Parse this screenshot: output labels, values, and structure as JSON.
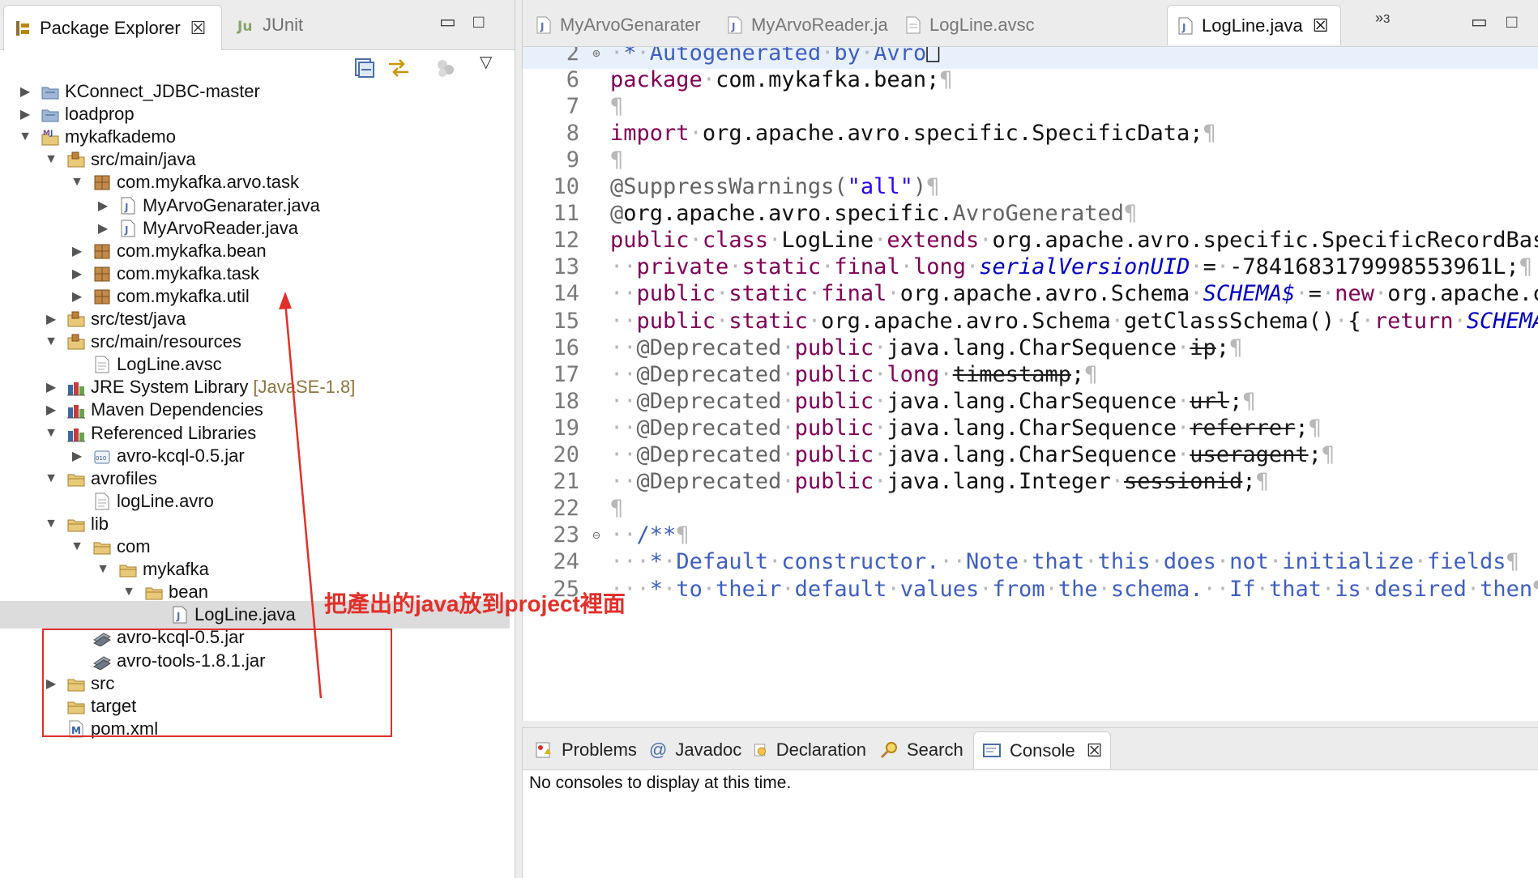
{
  "left_panel": {
    "tabs": [
      {
        "label": "Package Explorer",
        "icon": "package-explorer-icon",
        "active": true
      },
      {
        "label": "JUnit",
        "icon": "junit-icon",
        "active": false
      }
    ],
    "tree": [
      {
        "label": "KConnect_JDBC-master",
        "icon": "project-icon",
        "indent": 0,
        "expand": "collapsed"
      },
      {
        "label": "loadprop",
        "icon": "project-icon",
        "indent": 0,
        "expand": "collapsed"
      },
      {
        "label": "mykafkademo",
        "icon": "maven-project-icon",
        "indent": 0,
        "expand": "expanded"
      },
      {
        "label": "src/main/java",
        "icon": "source-folder-icon",
        "indent": 1,
        "expand": "expanded"
      },
      {
        "label": "com.mykafka.arvo.task",
        "icon": "package-icon",
        "indent": 2,
        "expand": "expanded"
      },
      {
        "label": "MyArvoGenarater.java",
        "icon": "java-file-icon",
        "indent": 3,
        "expand": "collapsed"
      },
      {
        "label": "MyArvoReader.java",
        "icon": "java-file-icon",
        "indent": 3,
        "expand": "collapsed"
      },
      {
        "label": "com.mykafka.bean",
        "icon": "package-icon",
        "indent": 2,
        "expand": "collapsed"
      },
      {
        "label": "com.mykafka.task",
        "icon": "package-icon",
        "indent": 2,
        "expand": "collapsed"
      },
      {
        "label": "com.mykafka.util",
        "icon": "package-icon",
        "indent": 2,
        "expand": "collapsed"
      },
      {
        "label": "src/test/java",
        "icon": "source-folder-icon",
        "indent": 1,
        "expand": "collapsed"
      },
      {
        "label": "src/main/resources",
        "icon": "source-folder-icon",
        "indent": 1,
        "expand": "expanded"
      },
      {
        "label": "LogLine.avsc",
        "icon": "text-file-icon",
        "indent": 2,
        "expand": "none"
      },
      {
        "label": "JRE System Library",
        "deco": "[JavaSE-1.8]",
        "icon": "library-icon",
        "indent": 1,
        "expand": "collapsed"
      },
      {
        "label": "Maven Dependencies",
        "icon": "library-icon",
        "indent": 1,
        "expand": "collapsed"
      },
      {
        "label": "Referenced Libraries",
        "icon": "library-icon",
        "indent": 1,
        "expand": "expanded"
      },
      {
        "label": "avro-kcql-0.5.jar",
        "icon": "jar-icon",
        "indent": 2,
        "expand": "collapsed"
      },
      {
        "label": "avrofiles",
        "icon": "folder-icon",
        "indent": 1,
        "expand": "expanded"
      },
      {
        "label": "logLine.avro",
        "icon": "text-file-icon",
        "indent": 2,
        "expand": "none"
      },
      {
        "label": "lib",
        "icon": "folder-icon",
        "indent": 1,
        "expand": "expanded"
      },
      {
        "label": "com",
        "icon": "folder-icon",
        "indent": 2,
        "expand": "expanded"
      },
      {
        "label": "mykafka",
        "icon": "folder-icon",
        "indent": 3,
        "expand": "expanded"
      },
      {
        "label": "bean",
        "icon": "folder-icon",
        "indent": 4,
        "expand": "expanded"
      },
      {
        "label": "LogLine.java",
        "icon": "java-file-icon",
        "indent": 5,
        "expand": "none",
        "selected": true
      },
      {
        "label": "avro-kcql-0.5.jar",
        "icon": "jar-lib-icon",
        "indent": 2,
        "expand": "none"
      },
      {
        "label": "avro-tools-1.8.1.jar",
        "icon": "jar-lib-icon",
        "indent": 2,
        "expand": "none"
      },
      {
        "label": "src",
        "icon": "folder-icon",
        "indent": 1,
        "expand": "collapsed"
      },
      {
        "label": "target",
        "icon": "folder-icon",
        "indent": 1,
        "expand": "none"
      },
      {
        "label": "pom.xml",
        "icon": "maven-file-icon",
        "indent": 1,
        "expand": "none"
      }
    ]
  },
  "editor": {
    "tabs": [
      {
        "label": "MyArvoGenarater",
        "icon": "java-file-icon",
        "active": false
      },
      {
        "label": "MyArvoReader.ja",
        "icon": "java-file-icon",
        "active": false
      },
      {
        "label": "LogLine.avsc",
        "icon": "text-file-icon",
        "active": false
      },
      {
        "label": "LogLine.java",
        "icon": "java-file-icon",
        "active": true
      }
    ],
    "overflow_count": "3",
    "lines": [
      {
        "n": "2",
        "fold": "⊕",
        "cur": true,
        "seg": [
          [
            "ws",
            "·"
          ],
          [
            "cm",
            "*"
          ],
          [
            "ws",
            "·"
          ],
          [
            "cm",
            "Autogenerated"
          ],
          [
            "ws",
            "·"
          ],
          [
            "cm",
            "by"
          ],
          [
            "ws",
            "·"
          ],
          [
            "cm",
            "Avro"
          ],
          [
            "tx",
            "⎕"
          ]
        ]
      },
      {
        "n": "6",
        "seg": [
          [
            "kw",
            "package"
          ],
          [
            "ws",
            "·"
          ],
          [
            "tx",
            "com.mykafka.bean;"
          ],
          [
            "ws",
            "¶"
          ]
        ]
      },
      {
        "n": "7",
        "seg": [
          [
            "ws",
            "¶"
          ]
        ]
      },
      {
        "n": "8",
        "seg": [
          [
            "kw",
            "import"
          ],
          [
            "ws",
            "·"
          ],
          [
            "tx",
            "org.apache.avro.specific.SpecificData;"
          ],
          [
            "ws",
            "¶"
          ]
        ]
      },
      {
        "n": "9",
        "seg": [
          [
            "ws",
            "¶"
          ]
        ]
      },
      {
        "n": "10",
        "seg": [
          [
            "an",
            "@SuppressWarnings("
          ],
          [
            "st",
            "\"all\""
          ],
          [
            "an",
            ")"
          ],
          [
            "ws",
            "¶"
          ]
        ]
      },
      {
        "n": "11",
        "seg": [
          [
            "an",
            "@"
          ],
          [
            "tx",
            "org.apache.avro.specific."
          ],
          [
            "an",
            "AvroGenerated"
          ],
          [
            "ws",
            "¶"
          ]
        ]
      },
      {
        "n": "12",
        "seg": [
          [
            "kw",
            "public"
          ],
          [
            "ws",
            "·"
          ],
          [
            "kw",
            "class"
          ],
          [
            "ws",
            "·"
          ],
          [
            "tx",
            "LogLine"
          ],
          [
            "ws",
            "·"
          ],
          [
            "kw",
            "extends"
          ],
          [
            "ws",
            "·"
          ],
          [
            "tx",
            "org.apache.avro.specific.SpecificRecordBas"
          ]
        ]
      },
      {
        "n": "13",
        "seg": [
          [
            "ws",
            "··"
          ],
          [
            "kw",
            "private"
          ],
          [
            "ws",
            "·"
          ],
          [
            "kw",
            "static"
          ],
          [
            "ws",
            "·"
          ],
          [
            "kw",
            "final"
          ],
          [
            "ws",
            "·"
          ],
          [
            "kw",
            "long"
          ],
          [
            "ws",
            "·"
          ],
          [
            "fi",
            "serialVersionUID"
          ],
          [
            "ws",
            "·"
          ],
          [
            "tx",
            "="
          ],
          [
            "ws",
            "·"
          ],
          [
            "tx",
            "-7841683179998553961L;"
          ],
          [
            "ws",
            "¶"
          ]
        ]
      },
      {
        "n": "14",
        "seg": [
          [
            "ws",
            "··"
          ],
          [
            "kw",
            "public"
          ],
          [
            "ws",
            "·"
          ],
          [
            "kw",
            "static"
          ],
          [
            "ws",
            "·"
          ],
          [
            "kw",
            "final"
          ],
          [
            "ws",
            "·"
          ],
          [
            "tx",
            "org.apache.avro.Schema"
          ],
          [
            "ws",
            "·"
          ],
          [
            "fi",
            "SCHEMA$"
          ],
          [
            "ws",
            "·"
          ],
          [
            "tx",
            "="
          ],
          [
            "ws",
            "·"
          ],
          [
            "kw",
            "new"
          ],
          [
            "ws",
            "·"
          ],
          [
            "tx",
            "org.apache.c"
          ]
        ]
      },
      {
        "n": "15",
        "seg": [
          [
            "ws",
            "··"
          ],
          [
            "kw",
            "public"
          ],
          [
            "ws",
            "·"
          ],
          [
            "kw",
            "static"
          ],
          [
            "ws",
            "·"
          ],
          [
            "tx",
            "org.apache.avro.Schema"
          ],
          [
            "ws",
            "·"
          ],
          [
            "tx",
            "getClassSchema()"
          ],
          [
            "ws",
            "·"
          ],
          [
            "tx",
            "{"
          ],
          [
            "ws",
            "·"
          ],
          [
            "kw",
            "return"
          ],
          [
            "ws",
            "·"
          ],
          [
            "fi",
            "SCHEMA"
          ]
        ]
      },
      {
        "n": "16",
        "seg": [
          [
            "ws",
            "··"
          ],
          [
            "an",
            "@Deprecated"
          ],
          [
            "ws",
            "·"
          ],
          [
            "kw",
            "public"
          ],
          [
            "ws",
            "·"
          ],
          [
            "tx",
            "java.lang.CharSequence"
          ],
          [
            "ws",
            "·"
          ],
          [
            "dep",
            "ip"
          ],
          [
            "tx",
            ";"
          ],
          [
            "ws",
            "¶"
          ]
        ]
      },
      {
        "n": "17",
        "seg": [
          [
            "ws",
            "··"
          ],
          [
            "an",
            "@Deprecated"
          ],
          [
            "ws",
            "·"
          ],
          [
            "kw",
            "public"
          ],
          [
            "ws",
            "·"
          ],
          [
            "kw",
            "long"
          ],
          [
            "ws",
            "·"
          ],
          [
            "dep",
            "timestamp"
          ],
          [
            "tx",
            ";"
          ],
          [
            "ws",
            "¶"
          ]
        ]
      },
      {
        "n": "18",
        "seg": [
          [
            "ws",
            "··"
          ],
          [
            "an",
            "@Deprecated"
          ],
          [
            "ws",
            "·"
          ],
          [
            "kw",
            "public"
          ],
          [
            "ws",
            "·"
          ],
          [
            "tx",
            "java.lang.CharSequence"
          ],
          [
            "ws",
            "·"
          ],
          [
            "dep",
            "url"
          ],
          [
            "tx",
            ";"
          ],
          [
            "ws",
            "¶"
          ]
        ]
      },
      {
        "n": "19",
        "seg": [
          [
            "ws",
            "··"
          ],
          [
            "an",
            "@Deprecated"
          ],
          [
            "ws",
            "·"
          ],
          [
            "kw",
            "public"
          ],
          [
            "ws",
            "·"
          ],
          [
            "tx",
            "java.lang.CharSequence"
          ],
          [
            "ws",
            "·"
          ],
          [
            "dep",
            "referrer"
          ],
          [
            "tx",
            ";"
          ],
          [
            "ws",
            "¶"
          ]
        ]
      },
      {
        "n": "20",
        "seg": [
          [
            "ws",
            "··"
          ],
          [
            "an",
            "@Deprecated"
          ],
          [
            "ws",
            "·"
          ],
          [
            "kw",
            "public"
          ],
          [
            "ws",
            "·"
          ],
          [
            "tx",
            "java.lang.CharSequence"
          ],
          [
            "ws",
            "·"
          ],
          [
            "dep",
            "useragent"
          ],
          [
            "tx",
            ";"
          ],
          [
            "ws",
            "¶"
          ]
        ]
      },
      {
        "n": "21",
        "seg": [
          [
            "ws",
            "··"
          ],
          [
            "an",
            "@Deprecated"
          ],
          [
            "ws",
            "·"
          ],
          [
            "kw",
            "public"
          ],
          [
            "ws",
            "·"
          ],
          [
            "tx",
            "java.lang.Integer"
          ],
          [
            "ws",
            "·"
          ],
          [
            "dep",
            "sessionid"
          ],
          [
            "tx",
            ";"
          ],
          [
            "ws",
            "¶"
          ]
        ]
      },
      {
        "n": "22",
        "seg": [
          [
            "ws",
            "¶"
          ]
        ]
      },
      {
        "n": "23",
        "fold": "⊖",
        "seg": [
          [
            "ws",
            "··"
          ],
          [
            "cm",
            "/**"
          ],
          [
            "ws",
            "¶"
          ]
        ]
      },
      {
        "n": "24",
        "seg": [
          [
            "ws",
            "···"
          ],
          [
            "cm",
            "*"
          ],
          [
            "ws",
            "·"
          ],
          [
            "cm",
            "Default"
          ],
          [
            "ws",
            "·"
          ],
          [
            "cm",
            "constructor."
          ],
          [
            "ws",
            "··"
          ],
          [
            "cm",
            "Note"
          ],
          [
            "ws",
            "·"
          ],
          [
            "cm",
            "that"
          ],
          [
            "ws",
            "·"
          ],
          [
            "cm",
            "this"
          ],
          [
            "ws",
            "·"
          ],
          [
            "cm",
            "does"
          ],
          [
            "ws",
            "·"
          ],
          [
            "cm",
            "not"
          ],
          [
            "ws",
            "·"
          ],
          [
            "cm",
            "initialize"
          ],
          [
            "ws",
            "·"
          ],
          [
            "cm",
            "fields"
          ],
          [
            "ws",
            "¶"
          ]
        ]
      },
      {
        "n": "25",
        "seg": [
          [
            "ws",
            "···"
          ],
          [
            "cm",
            "*"
          ],
          [
            "ws",
            "·"
          ],
          [
            "cm",
            "to"
          ],
          [
            "ws",
            "·"
          ],
          [
            "cm",
            "their"
          ],
          [
            "ws",
            "·"
          ],
          [
            "cm",
            "default"
          ],
          [
            "ws",
            "·"
          ],
          [
            "cm",
            "values"
          ],
          [
            "ws",
            "·"
          ],
          [
            "cm",
            "from"
          ],
          [
            "ws",
            "·"
          ],
          [
            "cm",
            "the"
          ],
          [
            "ws",
            "·"
          ],
          [
            "cm",
            "schema."
          ],
          [
            "ws",
            "··"
          ],
          [
            "cm",
            "If"
          ],
          [
            "ws",
            "·"
          ],
          [
            "cm",
            "that"
          ],
          [
            "ws",
            "·"
          ],
          [
            "cm",
            "is"
          ],
          [
            "ws",
            "·"
          ],
          [
            "cm",
            "desired"
          ],
          [
            "ws",
            "·"
          ],
          [
            "cm",
            "then"
          ],
          [
            "ws",
            "¶"
          ]
        ]
      }
    ]
  },
  "bottom_panel": {
    "tabs": [
      {
        "label": "Problems",
        "icon": "problems-icon",
        "active": false
      },
      {
        "label": "Javadoc",
        "icon": "javadoc-icon",
        "active": false
      },
      {
        "label": "Declaration",
        "icon": "declaration-icon",
        "active": false
      },
      {
        "label": "Search",
        "icon": "search-icon",
        "active": false
      },
      {
        "label": "Console",
        "icon": "console-icon",
        "active": true
      }
    ],
    "message": "No consoles to display at this time."
  },
  "annotation": {
    "text": "把產出的java放到project裡面",
    "color": "#e0302a"
  },
  "colors": {
    "keyword": "#7f0055",
    "comment": "#3f5fbf",
    "string": "#2a00ff",
    "annotation": "#646464",
    "field": "#0000c0",
    "selection": "#dcdcdc",
    "current_line": "#e8f0fb"
  }
}
